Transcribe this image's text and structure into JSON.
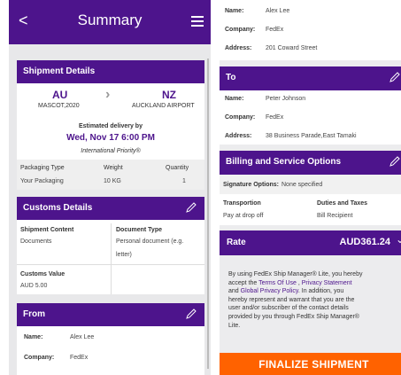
{
  "left": {
    "app_bar": {
      "back_glyph": "<",
      "title": "Summary",
      "menu_icon": "hamburger-menu-icon"
    },
    "shipment": {
      "header": "Shipment Details",
      "origin_code": "AU",
      "origin_name": "MASCOT,2020",
      "dest_code": "NZ",
      "dest_name": "AUCKLAND AIRPORT",
      "arrow": "›",
      "estimated_label": "Estimated delivery by",
      "estimated_date": "Wed, Nov 17 6:00 PM",
      "service": "International Priority®",
      "pkg_type_label": "Packaging Type",
      "pkg_type_value": "Your Packaging",
      "weight_label": "Weight",
      "weight_value": "10 KG",
      "qty_label": "Quantity",
      "qty_value": "1"
    },
    "customs": {
      "header": "Customs Details",
      "content_label": "Shipment Content",
      "content_value": "Documents",
      "doctype_label": "Document Type",
      "doctype_value_1": "Personal document (e.g.",
      "doctype_value_2": "letter)",
      "value_label": "Customs Value",
      "value_value": "AUD 5.00"
    },
    "from": {
      "header": "From",
      "name_label": "Name:",
      "name_value": "Alex Lee",
      "company_label": "Company:",
      "company_value": "FedEx"
    }
  },
  "right": {
    "from_top": {
      "name_label": "Name:",
      "name_value": "Alex Lee",
      "company_label": "Company:",
      "company_value": "FedEx",
      "address_label": "Address:",
      "address_value": "201 Coward Street"
    },
    "to": {
      "header": "To",
      "name_label": "Name:",
      "name_value": "Peter Johnson",
      "company_label": "Company:",
      "company_value": "FedEx",
      "address_label": "Address:",
      "address_value": "38 Business Parade,East Tamaki"
    },
    "billing": {
      "header": "Billing and Service Options",
      "signature_label": "Signature Options:",
      "signature_value": "None specified",
      "transport_label": "Transportion",
      "transport_value": "Pay at drop off",
      "duties_label": "Duties and Taxes",
      "duties_value": "Bill Recipient"
    },
    "rate": {
      "label": "Rate",
      "amount": "AUD361.24",
      "chevron": "⌄"
    },
    "disclaimer": {
      "line1": "By using FedEx Ship Manager® Lite, you hereby",
      "line2a": "accept the ",
      "terms": "Terms Of Use",
      "comma": " , ",
      "privacy": "Privacy Statement",
      "line3a": "and ",
      "global": "Global Privacy Policy",
      "line3b": ". In addition, you",
      "line4": "hereby represent and warrant that you are the",
      "line5": "user and/or subscriber of the contact details",
      "line6": "provided by you through FedEx Ship Manager®",
      "line7": "Lite."
    },
    "finalize_label": "FINALIZE SHIPMENT"
  },
  "colors": {
    "primary_purple": "#4d148c",
    "accent_orange": "#ff6200"
  }
}
